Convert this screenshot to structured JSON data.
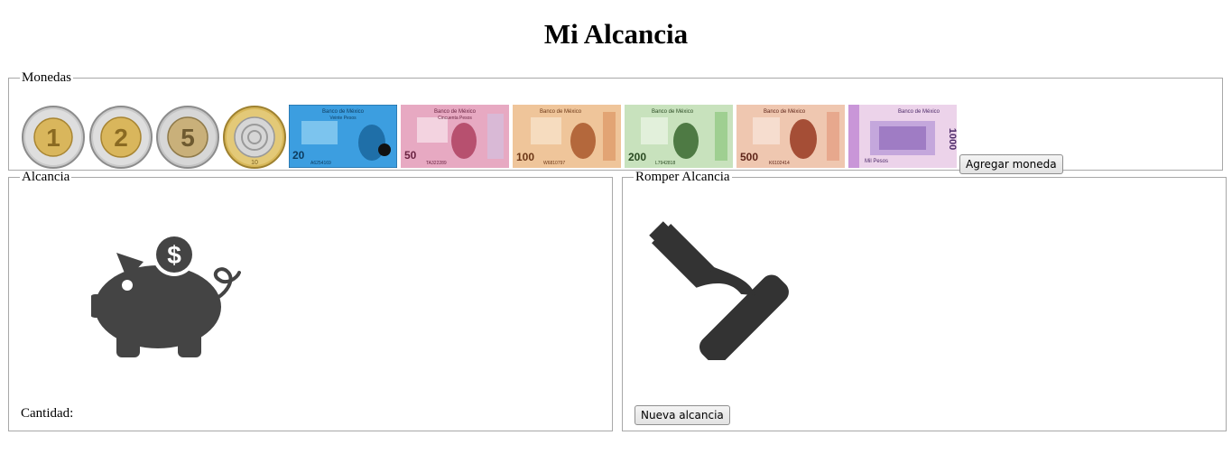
{
  "page": {
    "title": "Mi Alcancia"
  },
  "monedas": {
    "legend": "Monedas",
    "coins": [
      {
        "value": "1",
        "name": "coin-1-peso",
        "icon": "coin-1-peso-icon"
      },
      {
        "value": "2",
        "name": "coin-2-pesos",
        "icon": "coin-2-pesos-icon"
      },
      {
        "value": "5",
        "name": "coin-5-pesos",
        "icon": "coin-5-pesos-icon"
      },
      {
        "value": "10",
        "name": "coin-10-pesos",
        "icon": "coin-10-pesos-icon"
      }
    ],
    "bills": [
      {
        "value": "20",
        "bank": "Banco de México",
        "words": "Veinte Pesos",
        "serial": "A6254169",
        "name": "bill-20-pesos",
        "color": "#2d8fd6",
        "accent": "#7cc4ee"
      },
      {
        "value": "50",
        "bank": "Banco de México",
        "words": "Cincuenta Pesos",
        "serial": "TA322289",
        "name": "bill-50-pesos",
        "color": "#c55b8b",
        "accent": "#e9b6cc"
      },
      {
        "value": "100",
        "bank": "Banco de México",
        "words": "",
        "serial": "W6810797",
        "name": "bill-100-pesos",
        "color": "#d98a4e",
        "accent": "#f2d1a6"
      },
      {
        "value": "200",
        "bank": "Banco de México",
        "words": "",
        "serial": "L7942818",
        "name": "bill-200-pesos",
        "color": "#7bb36e",
        "accent": "#cfe4c3"
      },
      {
        "value": "500",
        "bank": "Banco de México",
        "words": "",
        "serial": "K6102414",
        "name": "bill-500-pesos",
        "color": "#c4674a",
        "accent": "#f0cdb9"
      },
      {
        "value": "1000",
        "bank": "Banco de México",
        "words": "Mil Pesos",
        "serial": "",
        "name": "bill-1000-pesos",
        "color": "#a77cc6",
        "accent": "#e3c6e6"
      }
    ],
    "add_button": "Agregar moneda"
  },
  "alcancia": {
    "legend": "Alcancia",
    "icon": "piggy-bank-icon",
    "cantidad_label": "Cantidad:"
  },
  "romper": {
    "legend": "Romper Alcancia",
    "icon": "hammer-icon",
    "new_button": "Nueva alcancia"
  },
  "colors": {
    "icon_dark": "#444444",
    "border": "#a8a8a8"
  }
}
